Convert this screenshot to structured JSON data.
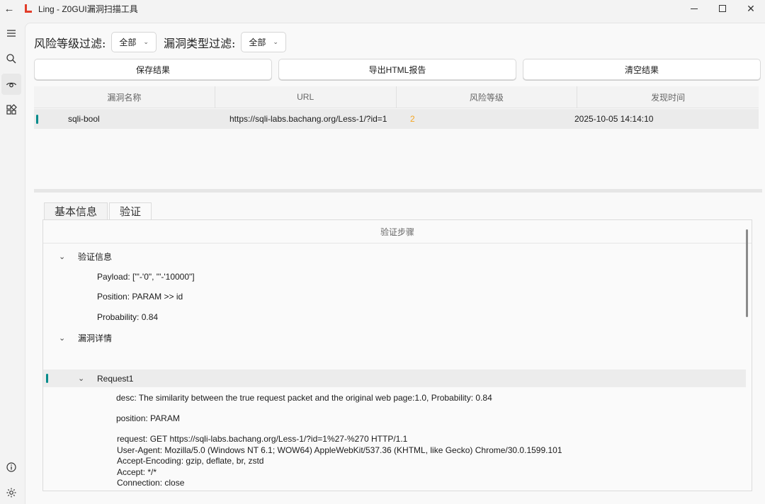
{
  "window": {
    "title": "Ling - Z0GUI漏洞扫描工具",
    "back_icon": "arrow-left-icon",
    "minimize_icon": "minimize-icon",
    "maximize_icon": "maximize-icon",
    "close_icon": "close-icon"
  },
  "sidebar": {
    "items": [
      {
        "icon": "hamburger-menu-icon",
        "active": false
      },
      {
        "icon": "search-icon",
        "active": false
      },
      {
        "icon": "eye-icon",
        "active": true
      },
      {
        "icon": "apps-grid-icon",
        "active": false
      },
      {
        "icon": "info-icon",
        "active": false
      },
      {
        "icon": "gear-icon",
        "active": false
      }
    ]
  },
  "filters": {
    "risk_label": "风险等级过滤:",
    "risk_value": "全部",
    "type_label": "漏洞类型过滤:",
    "type_value": "全部"
  },
  "actions": {
    "save": "保存结果",
    "export": "导出HTML报告",
    "clear": "清空结果"
  },
  "table": {
    "columns": [
      "漏洞名称",
      "URL",
      "风险等级",
      "发现时间"
    ],
    "rows": [
      {
        "name": "sqli-bool",
        "url": "https://sqli-labs.bachang.org/Less-1/?id=1",
        "risk": "2",
        "time": "2025-10-05 14:14:10"
      }
    ]
  },
  "detail_tabs": {
    "basic": "基本信息",
    "verify": "验证"
  },
  "verify_panel": {
    "header": "验证步骤",
    "verify_info": "验证信息",
    "payload": "Payload: [\"'-'0\", \"'-'10000\"]",
    "position": "Position: PARAM >> id",
    "probability": "Probability: 0.84",
    "vuln_detail": "漏洞详情",
    "request_node": "Request1",
    "desc": "desc: The similarity between the true request packet and the original web page:1.0, Probability: 0.84",
    "req_position": "position: PARAM",
    "request": "request: GET https://sqli-labs.bachang.org/Less-1/?id=1%27-%270 HTTP/1.1\nUser-Agent: Mozilla/5.0 (Windows NT 6.1; WOW64) AppleWebKit/537.36 (KHTML, like Gecko) Chrome/30.0.1599.101\nAccept-Encoding: gzip, deflate, br, zstd\nAccept: */*\nConnection: close\nHost: sqli-labs.bachang.org"
  }
}
